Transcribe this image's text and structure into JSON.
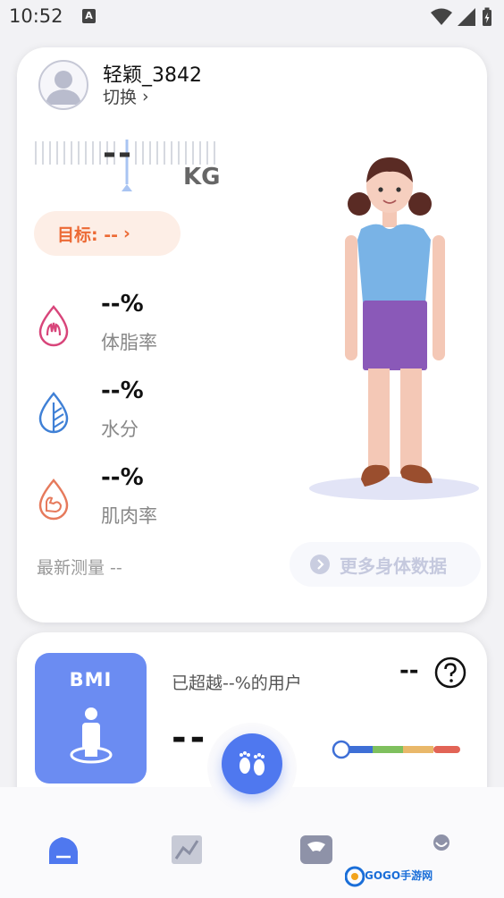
{
  "status_bar": {
    "time": "10:52",
    "notification_badge": "A"
  },
  "profile": {
    "username": "轻颖_3842",
    "switch_label": "切换",
    "switch_chevron": "›"
  },
  "weight": {
    "value": "--",
    "unit": "KG"
  },
  "goal": {
    "label": "目标: --",
    "chevron": "›"
  },
  "metrics": [
    {
      "value": "--%",
      "label": "体脂率",
      "icon": "body-fat-icon",
      "color": "#d8457a"
    },
    {
      "value": "--%",
      "label": "水分",
      "icon": "water-leaf-icon",
      "color": "#3f80d6"
    },
    {
      "value": "--%",
      "label": "肌肉率",
      "icon": "muscle-icon",
      "color": "#e67a5c"
    }
  ],
  "latest_measure": "最新测量 --",
  "more_data_button": "更多身体数据",
  "bmi": {
    "title": "BMI",
    "exceed_text": "已超越--%的用户",
    "right_value": "--",
    "value": "--"
  },
  "watermark_text": "GOGO手游网",
  "colors": {
    "accent": "#4f78ef",
    "goal_orange": "#ec6a35",
    "bmi_blue": "#6b8cf2"
  }
}
